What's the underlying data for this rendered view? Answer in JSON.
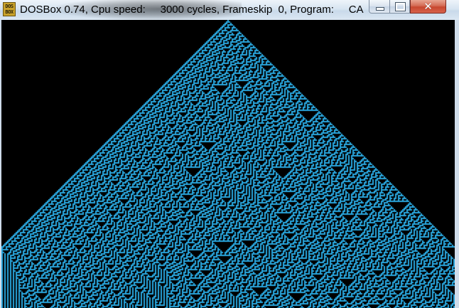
{
  "window": {
    "title": "DOSBox 0.74, Cpu speed:     3000 cycles, Frameskip  0, Program:     CA",
    "icon_label": "DOS BOX",
    "icon_name": "dosbox-icon",
    "buttons": {
      "minimize_icon": "minimize-icon",
      "maximize_icon": "maximize-icon",
      "close_icon": "close-icon",
      "close_glyph": "✕"
    }
  },
  "screen": {
    "content": "cellular-automaton",
    "background_color": "#000000",
    "cell_color": "#2aa8e0"
  }
}
